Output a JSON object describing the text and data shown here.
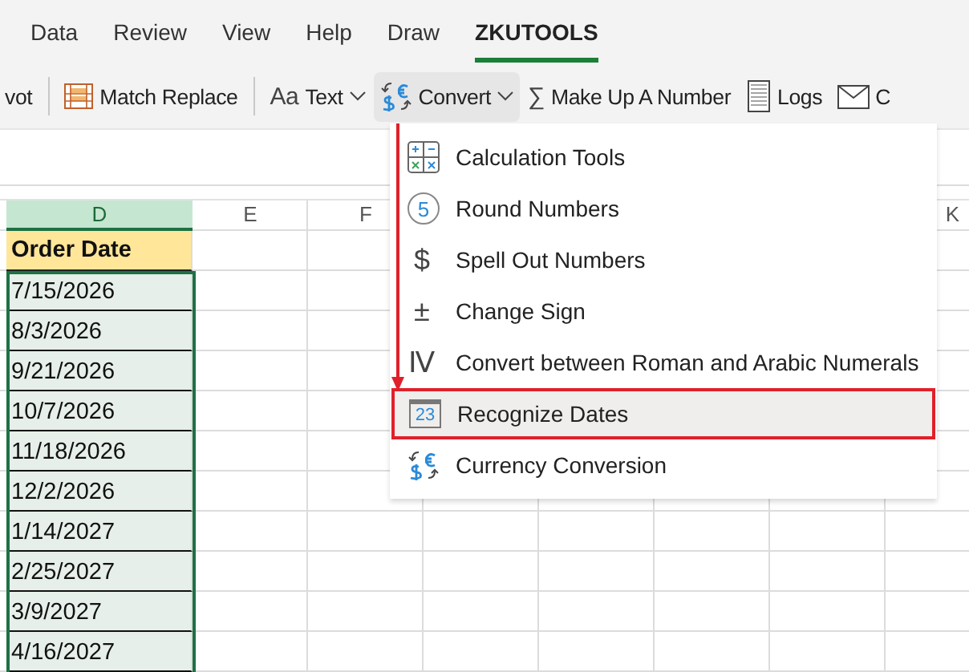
{
  "ribbon_tabs": [
    {
      "label": "Data",
      "selected": false
    },
    {
      "label": "Review",
      "selected": false
    },
    {
      "label": "View",
      "selected": false
    },
    {
      "label": "Help",
      "selected": false
    },
    {
      "label": "Draw",
      "selected": false
    },
    {
      "label": "ZKUTOOLS",
      "selected": true
    }
  ],
  "toolbar": [
    {
      "kind": "plain",
      "label": "vot",
      "dropdown": false,
      "active": false
    },
    {
      "kind": "table",
      "label": "Match Replace",
      "dropdown": false,
      "active": false
    },
    {
      "kind": "glyph",
      "glyph": "Aa",
      "label": "Text",
      "dropdown": true,
      "active": false
    },
    {
      "kind": "swap",
      "label": "Convert",
      "dropdown": true,
      "active": true
    },
    {
      "kind": "glyph",
      "glyph": "∑",
      "label": "Make Up A Number",
      "dropdown": false,
      "active": false
    },
    {
      "kind": "notepad",
      "label": "Logs",
      "dropdown": false,
      "active": false
    },
    {
      "kind": "mail",
      "label": "C",
      "dropdown": false,
      "active": false
    }
  ],
  "sheet": {
    "columns": [
      {
        "label": "D",
        "selected": true
      },
      {
        "label": "E",
        "selected": false
      },
      {
        "label": "F",
        "selected": false
      },
      {
        "label": "K",
        "selected": false
      }
    ],
    "header": "Order Date",
    "rows": [
      "7/15/2026",
      "8/3/2026",
      "9/21/2026",
      "10/7/2026",
      "11/18/2026",
      "12/2/2026",
      "1/14/2027",
      "2/25/2027",
      "3/9/2027",
      "4/16/2027"
    ]
  },
  "menu": {
    "items": [
      {
        "kind": "grid",
        "label": "Calculation Tools",
        "highlighted": false
      },
      {
        "kind": "circle",
        "glyph": "5",
        "label": "Round Numbers",
        "highlighted": false
      },
      {
        "kind": "plain",
        "glyph": "$",
        "label": "Spell Out Numbers",
        "highlighted": false
      },
      {
        "kind": "plain",
        "glyph": "±",
        "label": "Change Sign",
        "highlighted": false
      },
      {
        "kind": "plain",
        "glyph": "Ⅳ",
        "label": "Convert between Roman and Arabic Numerals",
        "highlighted": false
      },
      {
        "kind": "calendar",
        "glyph": "23",
        "label": "Recognize Dates",
        "highlighted": true
      },
      {
        "kind": "swap",
        "label": "Currency Conversion",
        "highlighted": false
      }
    ]
  }
}
